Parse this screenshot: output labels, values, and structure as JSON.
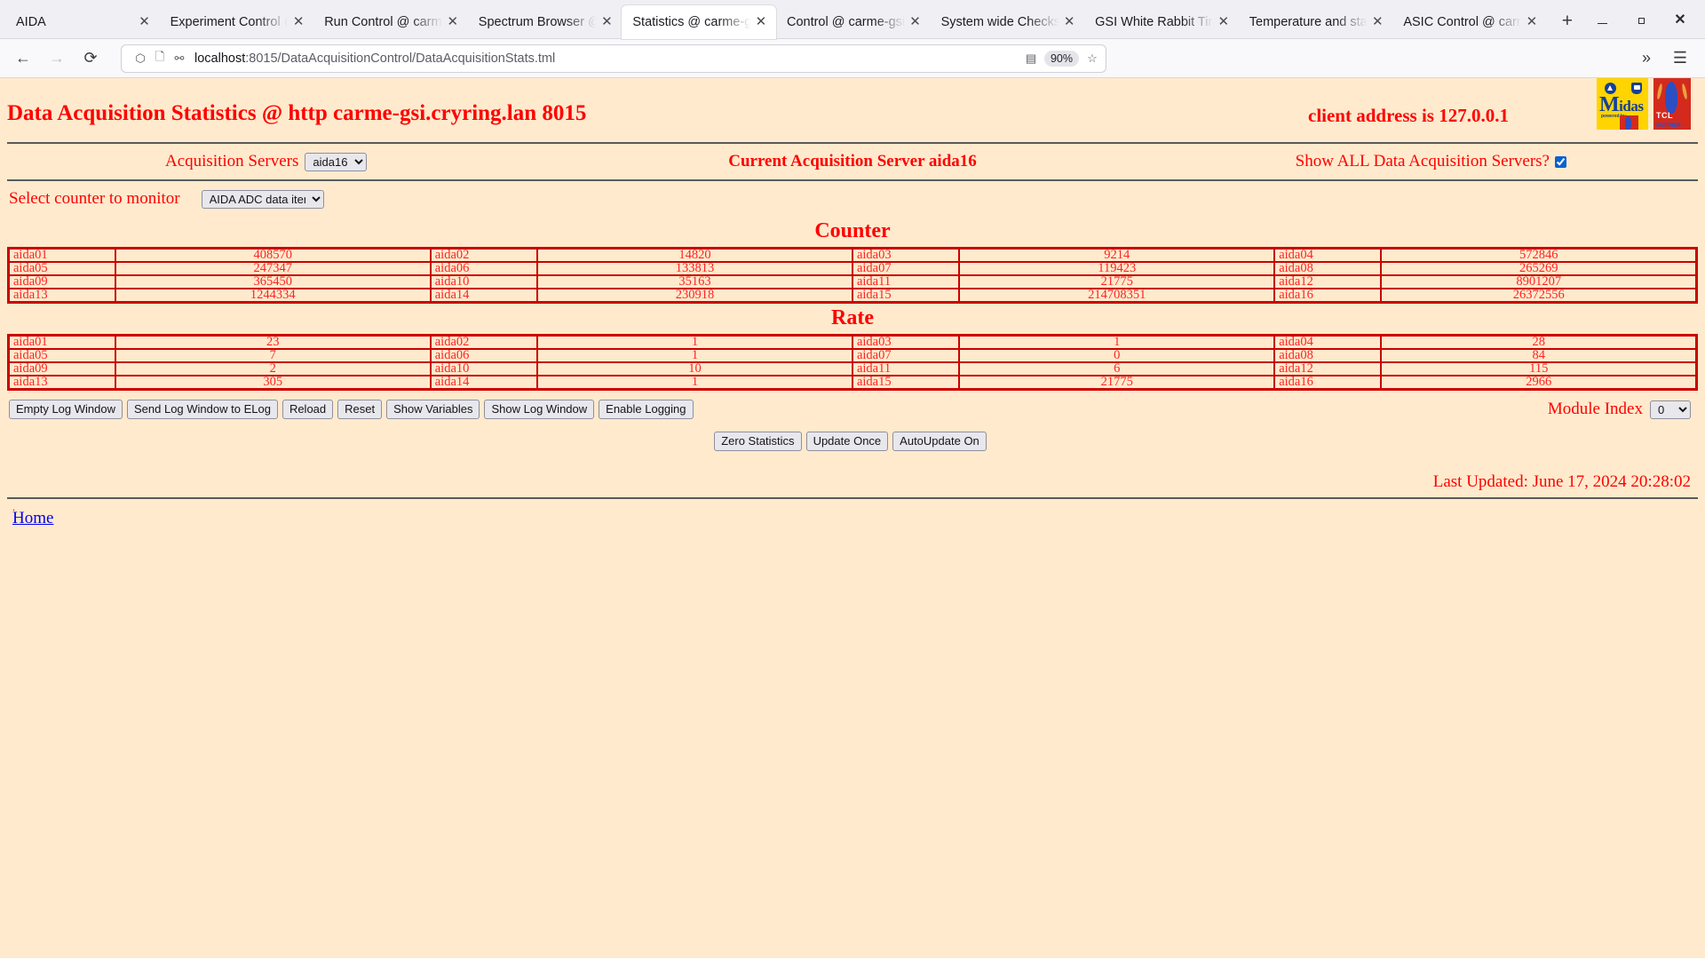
{
  "browser": {
    "tabs": [
      {
        "title": "AIDA",
        "active": false
      },
      {
        "title": "Experiment Control @ c",
        "active": false
      },
      {
        "title": "Run Control @ carme-",
        "active": false
      },
      {
        "title": "Spectrum Browser @ c",
        "active": false
      },
      {
        "title": "Statistics @ carme-gsi",
        "active": true
      },
      {
        "title": "Control @ carme-gsi",
        "active": false
      },
      {
        "title": "System wide Checks @",
        "active": false
      },
      {
        "title": "GSI White Rabbit Time",
        "active": false
      },
      {
        "title": "Temperature and status",
        "active": false
      },
      {
        "title": "ASIC Control @ carme-",
        "active": false
      }
    ],
    "tab_close_icon": "close-icon",
    "new_tab_label": "+",
    "window_minimize": "minimize-icon",
    "window_maximize": "maximize-icon",
    "window_close": "close-icon",
    "nav": {
      "back": "back-arrow-icon",
      "forward": "forward-arrow-icon",
      "reload": "reload-icon",
      "shield": "shield-icon",
      "page": "page-icon",
      "permissions": "permissions-icon",
      "reader": "reader-view-icon",
      "bookmark": "star-icon",
      "overflow": "chevron-double-right-icon",
      "menu": "hamburger-menu-icon"
    },
    "url": {
      "host": "localhost",
      "path": ":8015/DataAcquisitionControl/DataAcquisitionStats.tml",
      "zoom": "90%"
    }
  },
  "page": {
    "title": "Data Acquisition Statistics @ http carme-gsi.cryring.lan 8015",
    "client_address": "client address is 127.0.0.1",
    "logos": {
      "midas": {
        "word_big": "M",
        "word_rest": "idas",
        "powered_by": "powered by"
      },
      "tcl": {
        "word": "TCL",
        "sub": "PARTNER"
      }
    },
    "servers": {
      "label": "Acquisition Servers",
      "selected": "aida16",
      "options": [
        "aida16"
      ],
      "current_label": "Current Acquisition Server aida16",
      "show_all_label": "Show ALL Data Acquisition Servers?",
      "show_all_checked": true
    },
    "counter_select": {
      "label": "Select counter to monitor",
      "selected": "AIDA ADC data items",
      "options": [
        "AIDA ADC data items"
      ]
    },
    "counter_table": {
      "title": "Counter",
      "rows": [
        [
          {
            "name": "aida01",
            "value": "408570"
          },
          {
            "name": "aida02",
            "value": "14820"
          },
          {
            "name": "aida03",
            "value": "9214"
          },
          {
            "name": "aida04",
            "value": "572846"
          }
        ],
        [
          {
            "name": "aida05",
            "value": "247347"
          },
          {
            "name": "aida06",
            "value": "133813"
          },
          {
            "name": "aida07",
            "value": "119423"
          },
          {
            "name": "aida08",
            "value": "265269"
          }
        ],
        [
          {
            "name": "aida09",
            "value": "365450"
          },
          {
            "name": "aida10",
            "value": "35163"
          },
          {
            "name": "aida11",
            "value": "21775"
          },
          {
            "name": "aida12",
            "value": "8901207"
          }
        ],
        [
          {
            "name": "aida13",
            "value": "1244334"
          },
          {
            "name": "aida14",
            "value": "230918"
          },
          {
            "name": "aida15",
            "value": "214708351"
          },
          {
            "name": "aida16",
            "value": "26372556"
          }
        ]
      ]
    },
    "rate_table": {
      "title": "Rate",
      "rows": [
        [
          {
            "name": "aida01",
            "value": "23"
          },
          {
            "name": "aida02",
            "value": "1"
          },
          {
            "name": "aida03",
            "value": "1"
          },
          {
            "name": "aida04",
            "value": "28"
          }
        ],
        [
          {
            "name": "aida05",
            "value": "7"
          },
          {
            "name": "aida06",
            "value": "1"
          },
          {
            "name": "aida07",
            "value": "0"
          },
          {
            "name": "aida08",
            "value": "84"
          }
        ],
        [
          {
            "name": "aida09",
            "value": "2"
          },
          {
            "name": "aida10",
            "value": "10"
          },
          {
            "name": "aida11",
            "value": "6"
          },
          {
            "name": "aida12",
            "value": "115"
          }
        ],
        [
          {
            "name": "aida13",
            "value": "305"
          },
          {
            "name": "aida14",
            "value": "1"
          },
          {
            "name": "aida15",
            "value": "21775"
          },
          {
            "name": "aida16",
            "value": "2966"
          }
        ]
      ]
    },
    "buttons": {
      "empty_log": "Empty Log Window",
      "send_elog": "Send Log Window to ELog",
      "reload": "Reload",
      "reset": "Reset",
      "show_variables": "Show Variables",
      "show_log": "Show Log Window",
      "enable_logging": "Enable Logging",
      "zero_statistics": "Zero Statistics",
      "update_once": "Update Once",
      "autoupdate": "AutoUpdate On"
    },
    "module_index": {
      "label": "Module Index",
      "selected": "0",
      "options": [
        "0"
      ]
    },
    "last_updated": "Last Updated: June 17, 2024 20:28:02",
    "footer_dot": ".",
    "home_link": "Home"
  }
}
